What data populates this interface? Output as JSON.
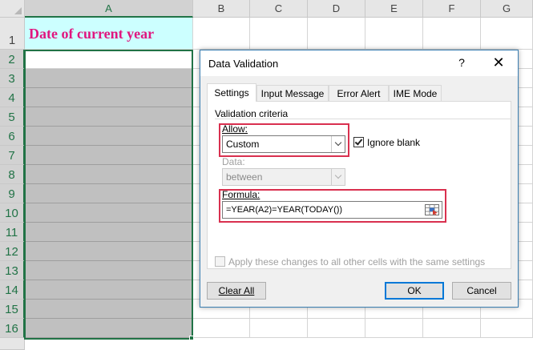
{
  "sheet": {
    "columns": [
      "A",
      "B",
      "C",
      "D",
      "E",
      "F",
      "G"
    ],
    "rows": [
      "1",
      "2",
      "3",
      "4",
      "5",
      "6",
      "7",
      "8",
      "9",
      "10",
      "11",
      "12",
      "13",
      "14",
      "15",
      "16"
    ],
    "a1_text": "Date of current year",
    "title_color": "#e0157f",
    "title_fill": "#ccffff",
    "range_fill": "#c0c0c0",
    "selection_color": "#217346"
  },
  "dialog": {
    "title": "Data Validation",
    "help_glyph": "?",
    "close_glyph": "✕",
    "tabs": [
      "Settings",
      "Input Message",
      "Error Alert",
      "IME Mode"
    ],
    "active_tab": "Settings",
    "group_label": "Validation criteria",
    "allow_label": "Allow:",
    "allow_value": "Custom",
    "ignore_blank_label": "Ignore blank",
    "ignore_blank_checked": true,
    "data_label": "Data:",
    "data_value": "between",
    "formula_label": "Formula:",
    "formula_value": "=YEAR(A2)=YEAR(TODAY())",
    "apply_all_label": "Apply these changes to all other cells with the same settings",
    "apply_all_checked": false,
    "clear_all_label": "Clear All",
    "ok_label": "OK",
    "cancel_label": "Cancel",
    "highlight_color": "#d9304f"
  }
}
